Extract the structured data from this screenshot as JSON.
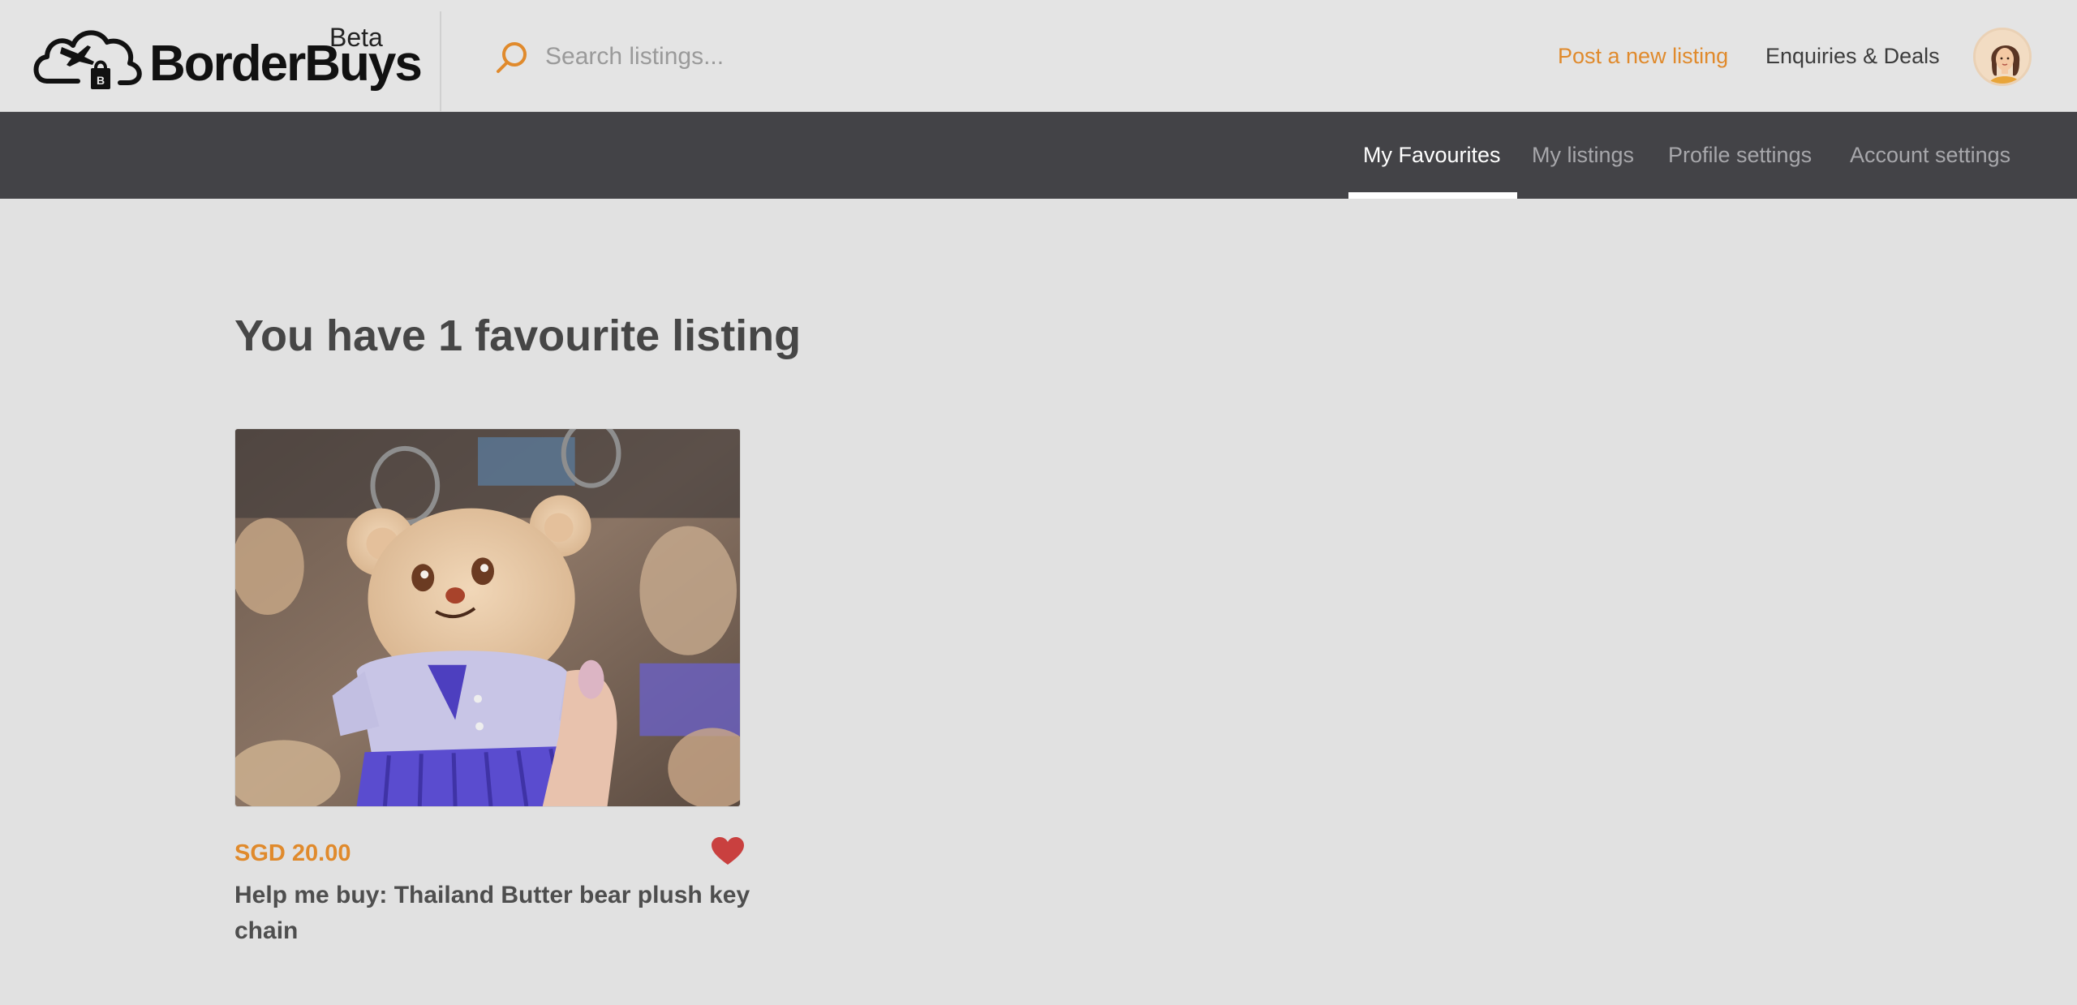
{
  "brand": {
    "name": "BorderBuys",
    "badge": "Beta"
  },
  "search": {
    "placeholder": "Search listings...",
    "icon": "search-icon"
  },
  "header": {
    "post_listing": "Post a new listing",
    "enquiries": "Enquiries & Deals",
    "avatar_icon": "user-avatar"
  },
  "subnav": {
    "tabs": [
      {
        "label": "My Favourites",
        "active": true
      },
      {
        "label": "My listings",
        "active": false
      },
      {
        "label": "Profile settings",
        "active": false
      },
      {
        "label": "Account settings",
        "active": false
      }
    ]
  },
  "main": {
    "title": "You have 1 favourite listing",
    "listings": [
      {
        "price": "SGD 20.00",
        "title": "Help me buy: Thailand Butter bear plush key chain",
        "favourited": true,
        "image_icon": "bear-plush-photo"
      }
    ]
  },
  "colors": {
    "accent": "#e08a2c",
    "nav_bg": "#434347",
    "page_bg": "#e1e1e1",
    "heart": "#c9403f"
  }
}
